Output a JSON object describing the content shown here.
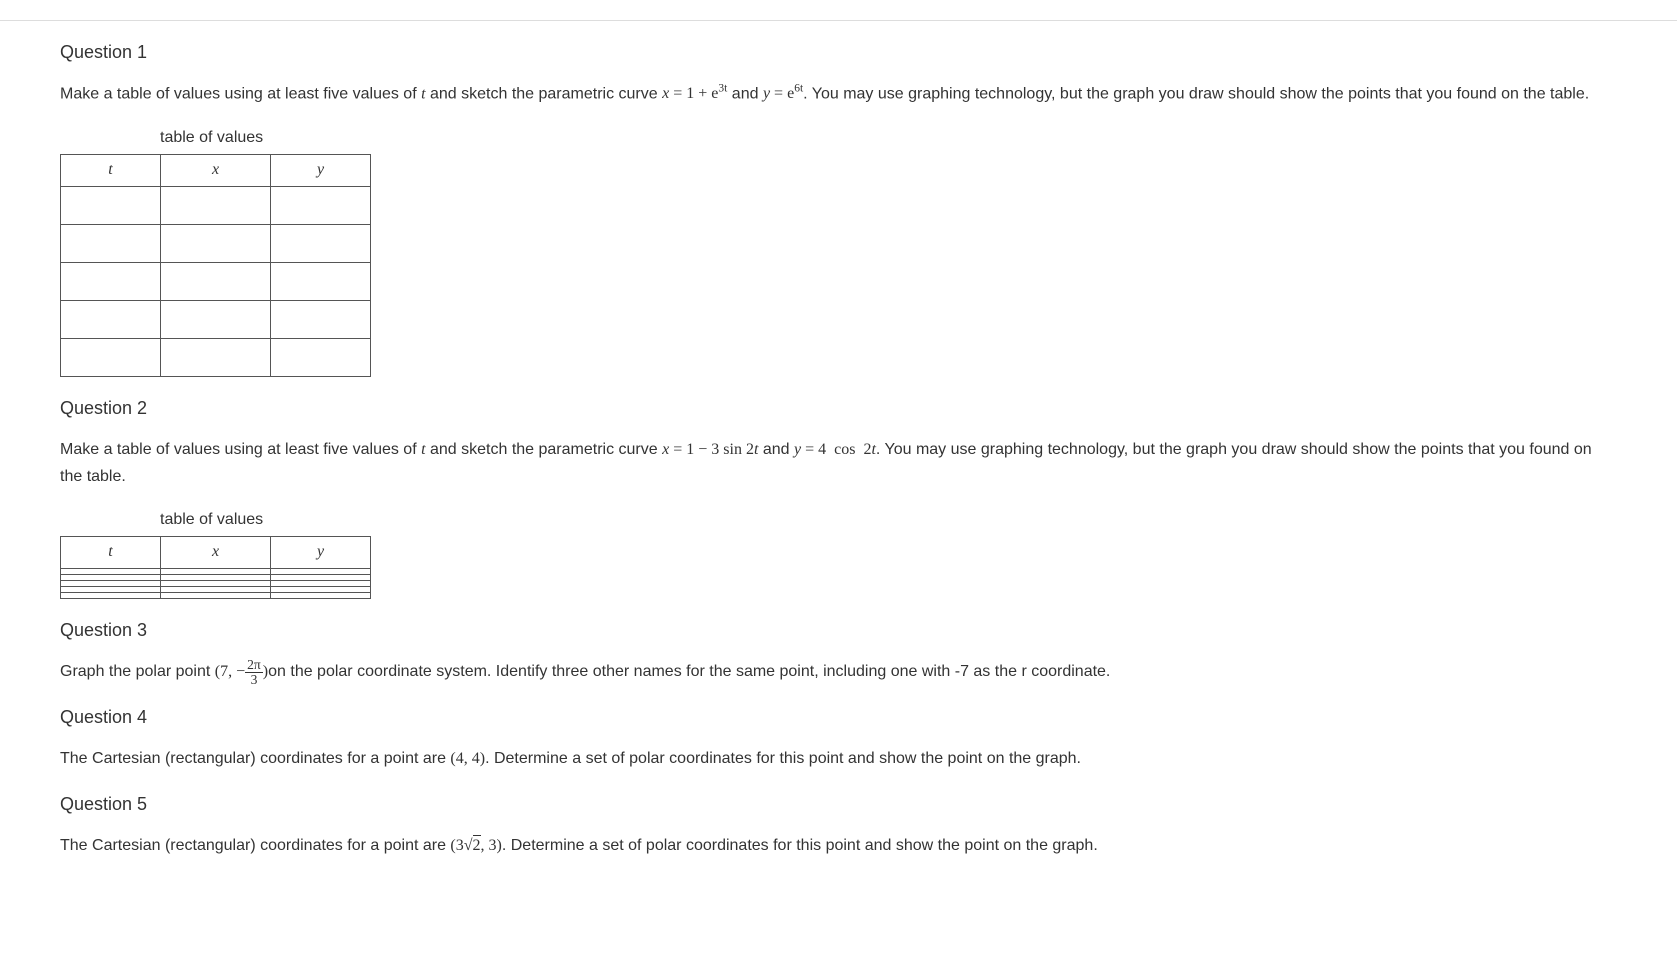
{
  "q1": {
    "title": "Question 1",
    "text_1": "Make a table of values using at least five values of ",
    "text_2": " and sketch the parametric curve ",
    "text_3": " and ",
    "text_4": ". You may use graphing technology, but the graph you draw should show the points that you found on the table.",
    "eq_x_lhs": "x",
    "eq_x_rhs_base": "1 + e",
    "eq_x_exp": "3t",
    "eq_y_lhs": "y",
    "eq_y_rhs_base": "e",
    "eq_y_exp": "6t",
    "table_caption": "table of values",
    "col_t": "t",
    "col_x": "x",
    "col_y": "y"
  },
  "q2": {
    "title": "Question 2",
    "text_1": "Make a table of values using at least five values of ",
    "text_2": " and sketch the parametric curve ",
    "text_3": " and ",
    "text_4": ". You may use graphing technology, but the graph you draw should show the points that you found on the table.",
    "eq_x": "x = 1 − 3 sin 2t",
    "eq_y": "y = 4  cos  2t",
    "table_caption": "table of values",
    "col_t": "t",
    "col_x": "x",
    "col_y": "y"
  },
  "q3": {
    "title": "Question 3",
    "text_1": "Graph the polar point ",
    "point_open": "(7, −",
    "frac_num": "2π",
    "frac_den": "3",
    "point_close": ")",
    "text_2": "on the polar coordinate system. Identify three other names for the same point, including one with -7 as the r coordinate."
  },
  "q4": {
    "title": "Question 4",
    "text_1": "The Cartesian (rectangular) coordinates for a point are ",
    "point": "(4, 4)",
    "text_2": ". Determine a set of polar coordinates for this point and show the point on the graph."
  },
  "q5": {
    "title": "Question 5",
    "text_1": "The Cartesian (rectangular) coordinates for a point are ",
    "point_open": "(3",
    "sqrt_arg": "2",
    "point_close": ", 3)",
    "text_2": ". Determine a set of polar coordinates for this point and show the point on the graph."
  },
  "t_var": "t"
}
